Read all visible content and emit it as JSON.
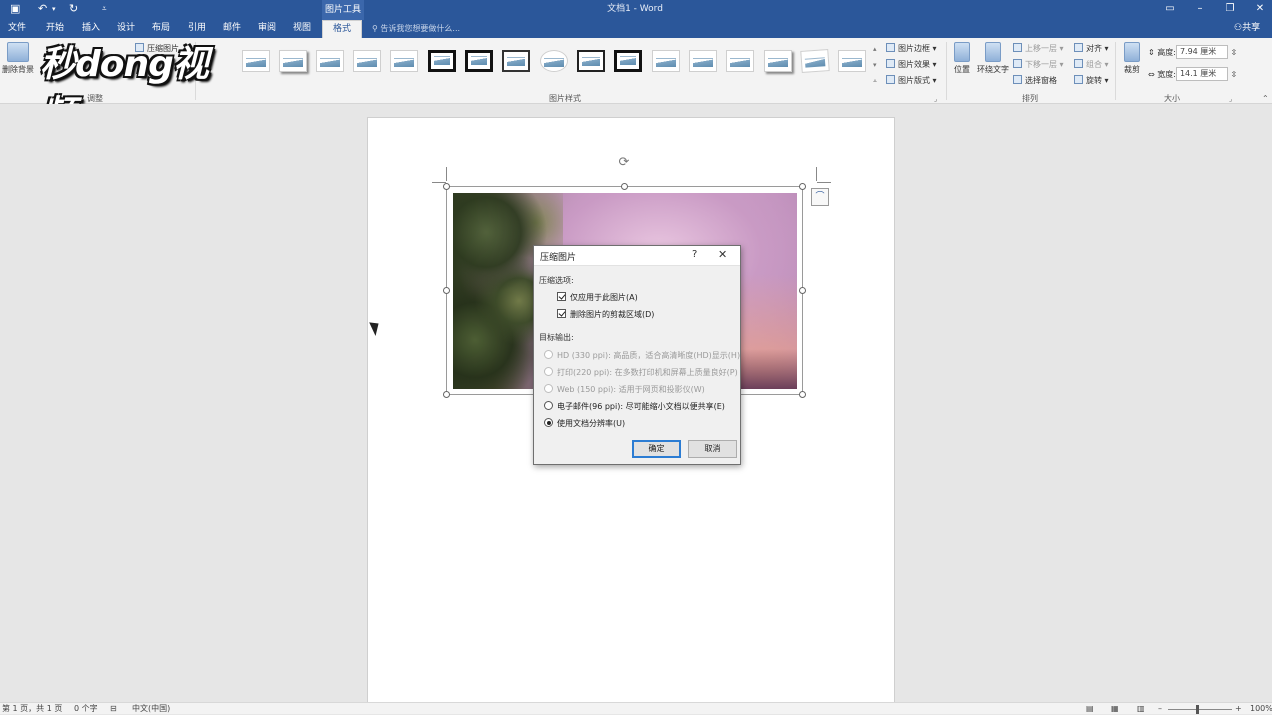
{
  "window": {
    "title": "文档1 - Word",
    "context_tab_group": "图片工具"
  },
  "tabs": [
    "文件",
    "开始",
    "插入",
    "设计",
    "布局",
    "引用",
    "邮件",
    "审阅",
    "视图",
    "格式"
  ],
  "active_tab": "格式",
  "tell_me": "告诉我您想要做什么...",
  "share": "共享",
  "ribbon": {
    "adjust": {
      "remove_bg": "删除背景",
      "compress": "压缩图片",
      "group": "调整"
    },
    "picture_styles": {
      "group": "图片样式",
      "border": "图片边框",
      "effects": "图片效果",
      "layout": "图片版式"
    },
    "arrange": {
      "position": "位置",
      "wrap": "环绕文字",
      "forward": "上移一层",
      "backward": "下移一层",
      "selection": "选择窗格",
      "align": "对齐",
      "group_objs": "组合",
      "rotate": "旋转",
      "group": "排列"
    },
    "size": {
      "crop": "裁剪",
      "height_label": "高度:",
      "height": "7.94 厘米",
      "width_label": "宽度:",
      "width": "14.1 厘米",
      "group": "大小"
    }
  },
  "watermark": {
    "text": "秒dong视频"
  },
  "dialog": {
    "title": "压缩图片",
    "help": "?",
    "close": "✕",
    "compress_options_label": "压缩选项:",
    "apply_only": "仅应用于此图片(A)",
    "delete_cropped": "删除图片的剪裁区域(D)",
    "target_output_label": "目标输出:",
    "options": [
      {
        "label": "HD (330 ppi): 高品质，适合高清晰度(HD)显示(H)",
        "enabled": false,
        "selected": false
      },
      {
        "label": "打印(220 ppi): 在多数打印机和屏幕上质量良好(P)",
        "enabled": false,
        "selected": false
      },
      {
        "label": "Web (150 ppi): 适用于网页和投影仪(W)",
        "enabled": false,
        "selected": false
      },
      {
        "label": "电子邮件(96 ppi): 尽可能缩小文档以便共享(E)",
        "enabled": true,
        "selected": false
      },
      {
        "label": "使用文档分辨率(U)",
        "enabled": true,
        "selected": true
      }
    ],
    "ok": "确定",
    "cancel": "取消"
  },
  "status": {
    "page": "第 1 页，共 1 页",
    "words": "0 个字",
    "lang": "中文(中国)",
    "zoom": "100%"
  },
  "colors": {
    "accent": "#2b579a"
  }
}
